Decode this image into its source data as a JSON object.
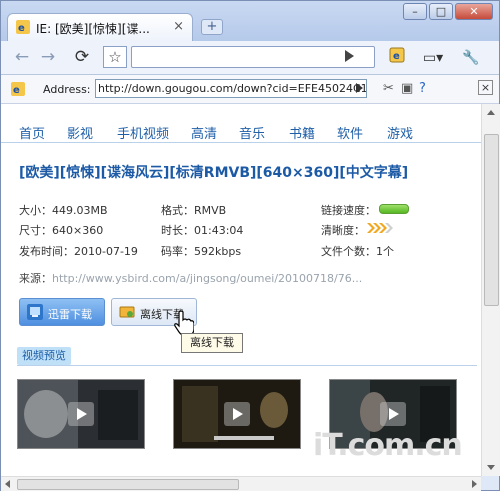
{
  "browser": {
    "tab_title": "IE: [欧美][惊悚][谍...",
    "new_tab_icon": "plus-icon",
    "address_label": "Address:",
    "url": "http://down.gougou.com/down?cid=EFE45024C1"
  },
  "site": {
    "nav": [
      "首页",
      "影视",
      "手机视频",
      "高清",
      "音乐",
      "书籍",
      "软件",
      "游戏"
    ],
    "title": "[欧美][惊悚][谍海风云][标清RMVB][640×360][中文字幕]",
    "info": {
      "size": "大小：449.03MB",
      "format": "格式：RMVB",
      "speed_label": "链接速度：",
      "resolution": "尺寸：640×360",
      "duration": "时长：01:43:04",
      "clarity_label": "清晰度：",
      "release": "发布时间：2010-07-19",
      "bitrate": "码率：592kbps",
      "file_count": "文件个数：1个",
      "source_label": "来源：",
      "source_url": "http://www.ysbird.com/a/jingsong/oumei/20100718/76..."
    },
    "buttons": {
      "xunlei": "迅雷下载",
      "offline": "离线下载",
      "tooltip": "离线下载"
    },
    "preview_label": "视频预览",
    "watermark": "iT.com.cn",
    "colors": {
      "link_blue": "#1f5fa8",
      "title_blue": "#1c5aa6",
      "speed_green": "#55b823"
    }
  }
}
